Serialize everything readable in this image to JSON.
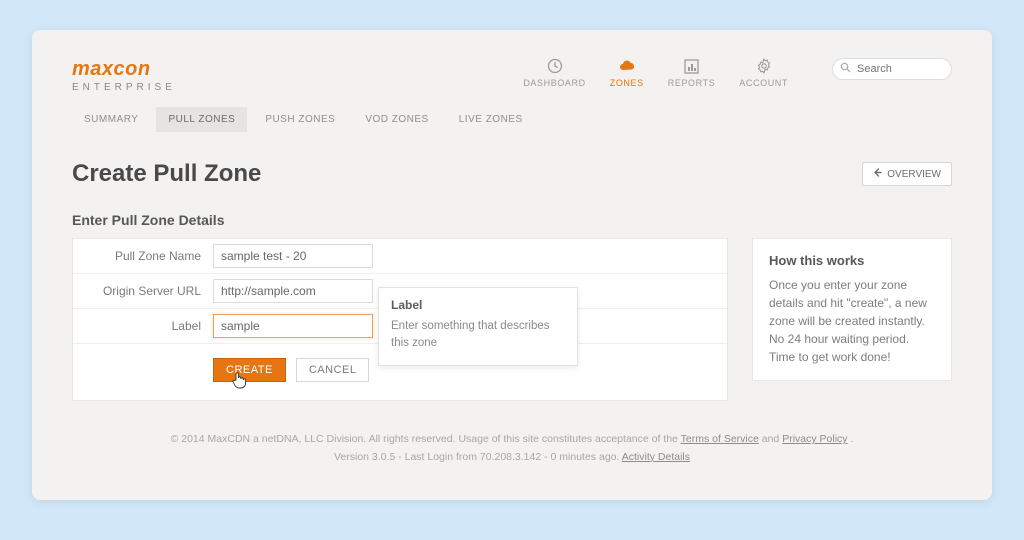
{
  "logo": {
    "brand": "maxcon",
    "sub": "ENTERPRISE"
  },
  "nav": {
    "items": [
      {
        "label": "DASHBOARD"
      },
      {
        "label": "ZONES"
      },
      {
        "label": "REPORTS"
      },
      {
        "label": "ACCOUNT"
      }
    ]
  },
  "search": {
    "placeholder": "Search"
  },
  "tabs": [
    {
      "label": "SUMMARY"
    },
    {
      "label": "PULL ZONES"
    },
    {
      "label": "PUSH ZONES"
    },
    {
      "label": "VOD ZONES"
    },
    {
      "label": "LIVE ZONES"
    }
  ],
  "page": {
    "title": "Create Pull Zone",
    "overview_btn": "OVERVIEW"
  },
  "form": {
    "heading": "Enter Pull Zone Details",
    "fields": {
      "name": {
        "label": "Pull Zone Name",
        "value": "sample test - 20"
      },
      "origin": {
        "label": "Origin Server URL",
        "value": "http://sample.com"
      },
      "zlabel": {
        "label": "Label",
        "value": "sample"
      }
    },
    "buttons": {
      "create": "CREATE",
      "cancel": "CANCEL"
    }
  },
  "tooltip": {
    "title": "Label",
    "body": "Enter something that describes this zone"
  },
  "help": {
    "title": "How this works",
    "body": "Once you enter your zone details and hit \"create\", a new zone will be created instantly. No 24 hour waiting period. Time to get work done!"
  },
  "footer": {
    "line1_a": "© 2014 MaxCDN a netDNA, LLC Division. All rights reserved. Usage of this site constitutes acceptance of the ",
    "tos": "Terms of Service",
    "and": " and ",
    "privacy": "Privacy Policy",
    "period": ".",
    "line2_a": "Version 3.0.5 - Last Login from 70.208.3.142 - 0 minutes ago. ",
    "activity": "Activity Details"
  }
}
